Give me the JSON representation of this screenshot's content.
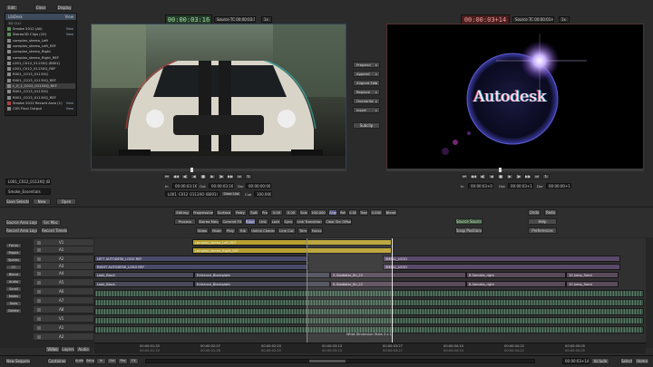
{
  "top_bar": {
    "menu": "Edit",
    "clear": "Clear",
    "display": "Display"
  },
  "library": {
    "title": "LibDesk",
    "view_label": "View",
    "group": "3D CLU",
    "items": [
      {
        "label": "Smoke 2012 (All)",
        "tag": "View",
        "color": "#5a8a5a"
      },
      {
        "label": "Stereo3D Clips (10)",
        "tag": "View",
        "color": "#5a8a5a"
      },
      {
        "label": "complex_stereo_Left",
        "tag": "",
        "color": "#888"
      },
      {
        "label": "complex_stereo_Left_REF",
        "tag": "",
        "color": "#888"
      },
      {
        "label": "complex_stereo_Right",
        "tag": "",
        "color": "#888"
      },
      {
        "label": "complex_stereo_Right_REF",
        "tag": "",
        "color": "#888"
      },
      {
        "label": "L001_C012_0113XQ (B001)",
        "tag": "",
        "color": "#888"
      },
      {
        "label": "L001_C012_0113XQ_REF",
        "tag": "",
        "color": "#888"
      },
      {
        "label": "R001_C013_0113XQ",
        "tag": "",
        "color": "#888"
      },
      {
        "label": "R001_C013_0113XQ_REF",
        "tag": "",
        "color": "#888"
      },
      {
        "label": "L_0_1_C012_0113XQ_REF",
        "tag": "",
        "color": "#888"
      },
      {
        "label": "R001_C013_0113XQ",
        "tag": "",
        "color": "#888"
      },
      {
        "label": "R001_C013_0113XQ_REF",
        "tag": "",
        "color": "#888"
      },
      {
        "label": "Smoke 2012 Record Area (1)",
        "tag": "View",
        "color": "#b04040"
      },
      {
        "label": "CXS Final Output",
        "tag": "View",
        "color": "#888"
      }
    ],
    "selected_clip": "L001_C012_0113XQ (B001)",
    "desk_label": "Smoke_Essentials",
    "save_selected": "Save Selected",
    "new": "New",
    "open": "Open"
  },
  "source_viewer": {
    "timecode": "00:00:03:16",
    "source_tc_label": "Source TC 00:00:03:16",
    "speed": "1x",
    "in_label": "In",
    "in_value": "00:00:03:16",
    "out_label": "Out",
    "out_value": "00:00:03:16",
    "dur_label": "Dur",
    "dur_value": "00:00:00:00",
    "clip_name": "L001_C012_0113XQ (B001)",
    "clear_list": "Clear List",
    "cue": "Cue",
    "frames": "100.000"
  },
  "record_viewer": {
    "timecode": "00:00:03+14",
    "source_tc_label": "Source TC 00:00:01+03",
    "speed": "1x",
    "logo_text": "Autodesk",
    "in_label": "In",
    "in_value": "00:00:03+00",
    "out_label": "Out",
    "out_value": "00:00:03+14",
    "dur_label": "Dur",
    "dur_value": "00:00:00+14"
  },
  "edit_buttons": [
    "Prepend",
    "Append",
    "Aligned Edit",
    "Replace",
    "Overwrite",
    "Insert"
  ],
  "subclip": "Subclip",
  "timeline_toolbar": {
    "row1": [
      "Editing",
      "Progressive",
      "Surface",
      "Patty",
      "Soft",
      "Pro",
      "0.00",
      "0.00",
      "Scale",
      "100.000",
      "Align",
      "Ref",
      "0.00",
      "Trans",
      "0.000",
      "Blend"
    ],
    "row2": [
      "Process",
      "Stereo Merge",
      "Commit FX",
      "Ripple",
      "Unk",
      "Lock",
      "Sync",
      "Link Transition",
      "Clear Src Offset"
    ],
    "row3": [
      "Video",
      "Mute",
      "Play",
      "Rlk",
      "Unlink Channel",
      "Link Cut",
      "Trim",
      "Focus"
    ],
    "source_area_layout": "Source Area Layout",
    "src_mac": "Src Mac",
    "record_area_layout": "Record Area Layout",
    "record_timeline": "Record Timeline",
    "undo": "Undo",
    "redo": "Redo",
    "help": "Help",
    "source_source": "Source Source",
    "snap_positioner": "Snap Positioner",
    "preferences": "Preferences"
  },
  "tracks": {
    "headers": [
      "V1",
      "A1",
      "A2",
      "A3",
      "A4",
      "A5",
      "A6",
      "A7",
      "A8"
    ],
    "side_labels": [
      "Focus",
      "Ripple",
      "Sparks",
      "CC",
      "Blend",
      "Audio",
      "Scroll",
      "Notes",
      "Tools",
      "Delete"
    ],
    "clips": [
      {
        "track": 0,
        "label": "complex_stereo_Left_REF",
        "color": "#b8a030"
      },
      {
        "track": 1,
        "label": "complex_stereo_Right_REF",
        "color": "#b8a030"
      },
      {
        "track": 2,
        "label": "LEFT AUTODESK_LOGO REF",
        "color": "#4a4a6a"
      },
      {
        "track": 2,
        "label": "RIGHT AUTODESK_LOGO REF",
        "color": "#4a4a6a"
      },
      {
        "track": 2,
        "label": "SMALL_LOGO",
        "color": "#5a4a6a"
      },
      {
        "track": 2,
        "label": "SMALL_LOGO",
        "color": "#5a4a6a"
      },
      {
        "track": 3,
        "label": "Look_Black",
        "color": "#4a4a5a"
      },
      {
        "track": 3,
        "label": "Entrance_Blackplate",
        "color": "#4a4a5a"
      },
      {
        "track": 3,
        "label": "5-Gladiator_fin_22",
        "color": "#5a4a5a"
      },
      {
        "track": 3,
        "label": "6-Sandals_right",
        "color": "#5a4a5a"
      },
      {
        "track": 3,
        "label": "10 Jump_Sand",
        "color": "#5a4a5a"
      },
      {
        "track": 4,
        "label": "Look_Black",
        "color": "#4a4a5a"
      },
      {
        "track": 4,
        "label": "Entrance_Blackplate",
        "color": "#4a4a5a"
      },
      {
        "track": 4,
        "label": "5-Gladiator_fin_22",
        "color": "#5a4a5a"
      },
      {
        "track": 4,
        "label": "6-Sandals_right",
        "color": "#5a4a5a"
      },
      {
        "track": 4,
        "label": "10 Jump_Sand",
        "color": "#5a4a5a"
      }
    ],
    "h_labels": [
      "H 0",
      "7 19",
      "H 0",
      "7 19",
      "H 0"
    ],
    "audio_caption": "What Dimension Tests 3 x 1"
  },
  "ruler": [
    "00:00:01:25",
    "00:00:02:07",
    "00:00:02:20",
    "00:00:03:13",
    "00:00:03:27",
    "00:00:04:10",
    "00:00:04:22",
    "00:00:05:05"
  ],
  "ruler_sub": [
    "00:00:01:10",
    "00:00:01:28",
    "00:00:02:20",
    "00:00:03:13",
    "00:00:03:27",
    "00:00:04:10",
    "00:00:04:22",
    "00:00:05:05"
  ],
  "timeline_tabs": [
    "Video",
    "Layers",
    "Audio"
  ],
  "bottom_bar": {
    "new_sequence": "New Sequence",
    "container": "Container",
    "mode_labels": [
      "Audio",
      "Setup",
      "In",
      "Out",
      "Pos",
      "FX"
    ],
    "position_tc": "00:00:03+14",
    "include": "Include",
    "select": "Select",
    "home": "Home"
  }
}
